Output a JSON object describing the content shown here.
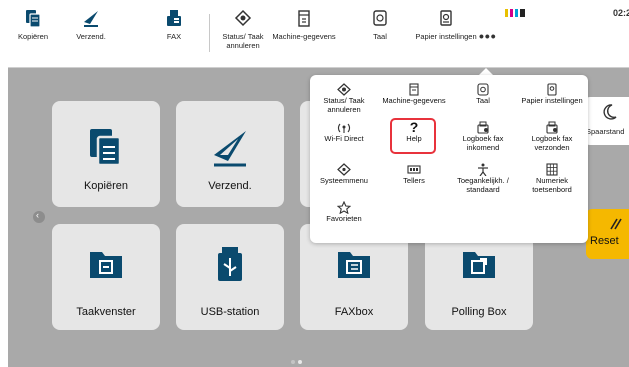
{
  "topbar": {
    "items": [
      {
        "label": "Kopiëren",
        "icon": "copy-icon"
      },
      {
        "label": "Verzend.",
        "icon": "send-icon"
      },
      {
        "label": "FAX",
        "icon": "fax-icon"
      },
      {
        "label": "Status/ Taak annuleren",
        "icon": "status-icon"
      },
      {
        "label": "Machine-gegevens",
        "icon": "machine-info-icon"
      },
      {
        "label": "Taal",
        "icon": "language-icon"
      },
      {
        "label": "Papier instellingen",
        "icon": "paper-settings-icon"
      }
    ],
    "more": "•••",
    "clock": "02:2",
    "status_colors": [
      "#e8c000",
      "#d0008a",
      "#00a0d8",
      "#222222"
    ]
  },
  "popup": {
    "items": [
      {
        "label": "Status/ Taak annuleren",
        "icon": "status-icon"
      },
      {
        "label": "Machine-gegevens",
        "icon": "machine-info-icon"
      },
      {
        "label": "Taal",
        "icon": "language-icon"
      },
      {
        "label": "Papier instellingen",
        "icon": "paper-settings-icon"
      },
      {
        "label": "Wi-Fi Direct",
        "icon": "wifi-direct-icon"
      },
      {
        "label": "Help",
        "icon": "help-icon"
      },
      {
        "label": "Logboek fax inkomend",
        "icon": "fax-log-in-icon"
      },
      {
        "label": "Logboek fax verzonden",
        "icon": "fax-log-out-icon"
      },
      {
        "label": "Systeemmenu",
        "icon": "system-menu-icon"
      },
      {
        "label": "Tellers",
        "icon": "counter-icon"
      },
      {
        "label": "Toegankelijkh. / standaard",
        "icon": "accessibility-icon"
      },
      {
        "label": "Numeriek toetsenbord",
        "icon": "numeric-keypad-icon"
      },
      {
        "label": "Favorieten",
        "icon": "favorites-icon"
      }
    ]
  },
  "tiles": [
    {
      "label": "Kopiëren",
      "icon": "copy-icon"
    },
    {
      "label": "Verzend.",
      "icon": "send-icon"
    },
    {
      "label": "Taakvenster",
      "icon": "job-box-icon"
    },
    {
      "label": "USB-station",
      "icon": "usb-drive-icon"
    },
    {
      "label": "FAXbox",
      "icon": "fax-box-icon"
    },
    {
      "label": "Polling Box",
      "icon": "polling-box-icon"
    }
  ],
  "side": {
    "sleep_label": "Spaarstand",
    "reset_label": "Reset"
  },
  "colors": {
    "accent": "#0a4a6e",
    "reset": "#f5b800",
    "highlight": "#e8323c",
    "background": "#a9a9a9"
  }
}
